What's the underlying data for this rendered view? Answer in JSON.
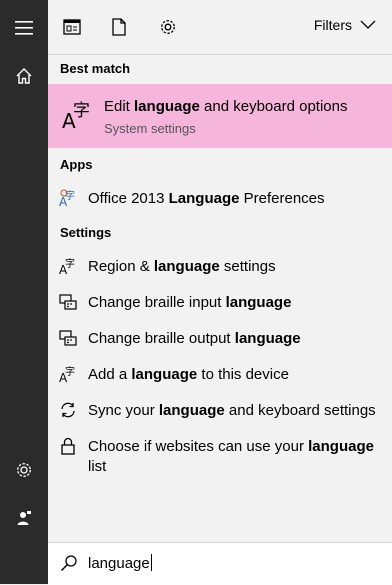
{
  "rail": {
    "menu_icon": "hamburger-icon",
    "home_icon": "home-icon",
    "settings_icon": "gear-icon",
    "feedback_icon": "person-feedback-icon"
  },
  "toolbar": {
    "apps_icon": "apps-icon",
    "documents_icon": "document-icon",
    "settings_icon": "gear-icon",
    "filters_label": "Filters"
  },
  "sections": {
    "best_match": "Best match",
    "apps": "Apps",
    "settings": "Settings"
  },
  "best_match": {
    "title_pre": "Edit ",
    "title_bold": "language",
    "title_post": " and keyboard options",
    "subtitle": "System settings",
    "highlight_color": "#f6b6dc"
  },
  "apps": [
    {
      "pre": "Office 2013 ",
      "bold": "Language",
      "post": " Preferences",
      "icon": "office-language-icon"
    }
  ],
  "settings": [
    {
      "pre": "Region & ",
      "bold": "language",
      "post": " settings",
      "icon": "language-icon"
    },
    {
      "pre": "Change braille input ",
      "bold": "language",
      "post": "",
      "icon": "braille-icon"
    },
    {
      "pre": "Change braille output ",
      "bold": "language",
      "post": "",
      "icon": "braille-icon"
    },
    {
      "pre": "Add a ",
      "bold": "language",
      "post": " to this device",
      "icon": "language-icon"
    },
    {
      "pre": "Sync your ",
      "bold": "language",
      "post": " and keyboard settings",
      "icon": "sync-icon"
    },
    {
      "pre": "Choose if websites can use your ",
      "bold": "language",
      "post": " list",
      "icon": "lock-icon"
    }
  ],
  "search": {
    "icon": "search-icon",
    "value": "language"
  }
}
